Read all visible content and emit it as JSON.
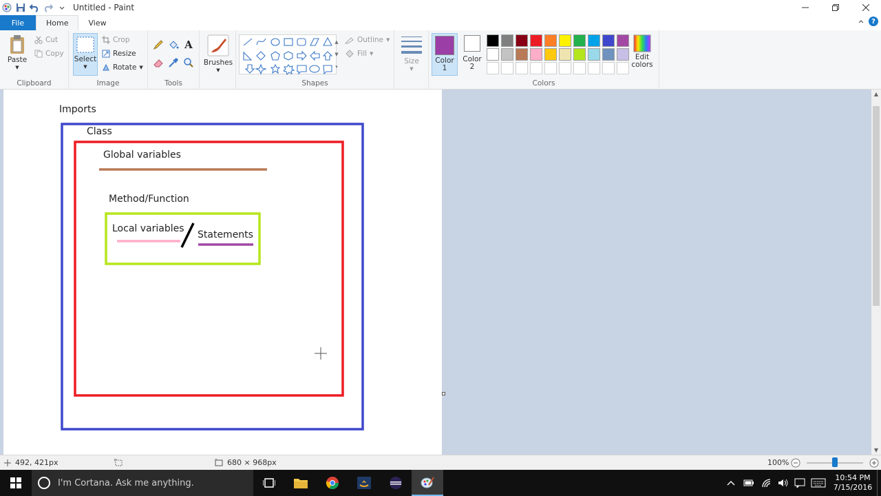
{
  "window": {
    "title": "Untitled - Paint",
    "icons": [
      "paint-app-icon",
      "save-icon",
      "undo-icon",
      "redo-icon",
      "customize-qat-icon"
    ]
  },
  "tabs": [
    {
      "label": "File"
    },
    {
      "label": "Home"
    },
    {
      "label": "View"
    }
  ],
  "ribbon": {
    "clipboard": {
      "label": "Clipboard",
      "paste": "Paste",
      "cut": "Cut",
      "copy": "Copy"
    },
    "image": {
      "label": "Image",
      "select": "Select",
      "crop": "Crop",
      "resize": "Resize",
      "rotate": "Rotate"
    },
    "tools": {
      "label": "Tools"
    },
    "brushes": {
      "label": "Brushes"
    },
    "shapes": {
      "label": "Shapes",
      "outline": "Outline",
      "fill": "Fill"
    },
    "size": {
      "label": "Size"
    },
    "colors": {
      "label": "Colors",
      "color1_label": "Color 1",
      "color2_label": "Color 2",
      "edit_colors": "Edit colors",
      "color1": "#9b3fa6",
      "color2": "#ffffff",
      "palette_row1": [
        "#000000",
        "#7f7f7f",
        "#880015",
        "#ed1c24",
        "#ff7f27",
        "#fff200",
        "#22b14c",
        "#00a2e8",
        "#3f48cc",
        "#a349a4"
      ],
      "palette_row2": [
        "#ffffff",
        "#c3c3c3",
        "#b97a57",
        "#ffaec9",
        "#ffc90e",
        "#efe4b0",
        "#b5e61d",
        "#99d9ea",
        "#7092be",
        "#c8bfe7"
      ]
    }
  },
  "canvas": {
    "imports": "Imports",
    "class": "Class",
    "global_variables": "Global variables",
    "method_function": "Method/Function",
    "local_variables": "Local variables",
    "statements": "Statements",
    "colors": {
      "class_box": "#3f48cc",
      "method_box": "#ed1c24",
      "block_box": "#b5e61d",
      "global_underline": "#b97a57",
      "local_underline": "#ffaec9",
      "statements_underline": "#a349a4"
    }
  },
  "status": {
    "cursor_pos": "492, 421px",
    "image_size": "680 × 968px",
    "zoom": "100%"
  },
  "taskbar": {
    "search_placeholder": "I'm Cortana. Ask me anything.",
    "time": "10:54 PM",
    "date": "7/15/2016"
  }
}
